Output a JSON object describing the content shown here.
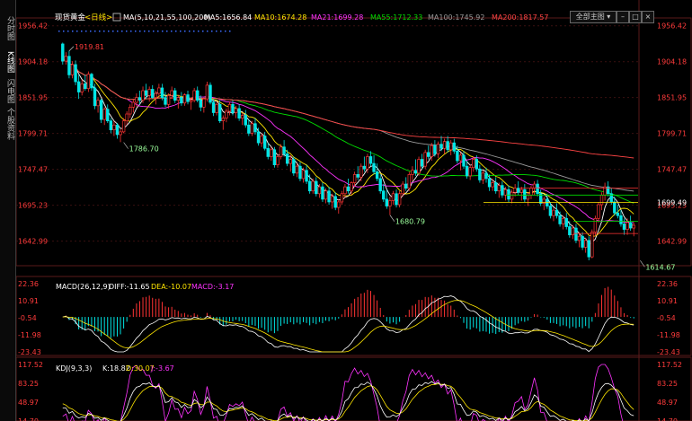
{
  "sidebar": {
    "tabs": [
      {
        "label": "分时图",
        "active": false
      },
      {
        "label": "K线图",
        "active": true
      },
      {
        "label": "闪电图",
        "active": false
      },
      {
        "label": "个股资料",
        "active": false
      }
    ]
  },
  "header": {
    "instrument": "现货黄金",
    "period": "<日线>",
    "ma_title": "MA(5,10,21,55,100,200)",
    "ma5": "MA5:1656.84",
    "ma10": "MA10:1674.28",
    "ma21": "MA21:1699.28",
    "ma55": "MA55:1712.33",
    "ma100": "MA100:1745.92",
    "ma200": "MA200:1817.57",
    "main_select": "全部主图"
  },
  "colors": {
    "up": "#ff3333",
    "down": "#00e5e5",
    "ma5": "#ffffff",
    "ma10": "#ffe600",
    "ma21": "#ff33ff",
    "ma55": "#00dd00",
    "ma100": "#9a9a9a",
    "ma200": "#ff4444",
    "axis_text": "#ff3b3b",
    "grid": "#3a1010"
  },
  "chart_data": [
    {
      "type": "candlestick",
      "title": "现货黄金 <日线>",
      "y_ticks": [
        "1956.42",
        "1904.18",
        "1851.95",
        "1799.71",
        "1747.47",
        "1695.23",
        "1642.99"
      ],
      "ylim": [
        1615,
        1960
      ],
      "annotations": [
        {
          "label": "1919.81",
          "index": 2,
          "value": 1919.81
        },
        {
          "label": "1786.70",
          "index": 19,
          "value": 1786.7
        },
        {
          "label": "1680.79",
          "index": 102,
          "value": 1680.79
        },
        {
          "label": "1614.67",
          "index": 180,
          "value": 1614.67
        }
      ],
      "price_label": "1699.49",
      "ohlc": [
        [
          1930,
          1932,
          1900,
          1905
        ],
        [
          1905,
          1918,
          1900,
          1912
        ],
        [
          1912,
          1920,
          1880,
          1885
        ],
        [
          1885,
          1905,
          1880,
          1900
        ],
        [
          1900,
          1906,
          1870,
          1875
        ],
        [
          1875,
          1885,
          1850,
          1860
        ],
        [
          1860,
          1878,
          1855,
          1872
        ],
        [
          1872,
          1885,
          1862,
          1865
        ],
        [
          1865,
          1890,
          1860,
          1886
        ],
        [
          1886,
          1888,
          1862,
          1866
        ],
        [
          1866,
          1872,
          1835,
          1840
        ],
        [
          1840,
          1852,
          1830,
          1848
        ],
        [
          1848,
          1850,
          1815,
          1820
        ],
        [
          1820,
          1838,
          1812,
          1835
        ],
        [
          1835,
          1842,
          1815,
          1818
        ],
        [
          1818,
          1822,
          1800,
          1805
        ],
        [
          1805,
          1818,
          1796,
          1812
        ],
        [
          1812,
          1815,
          1792,
          1798
        ],
        [
          1798,
          1806,
          1787,
          1802
        ],
        [
          1802,
          1822,
          1800,
          1818
        ],
        [
          1818,
          1832,
          1812,
          1828
        ],
        [
          1828,
          1842,
          1822,
          1838
        ],
        [
          1838,
          1850,
          1830,
          1845
        ],
        [
          1845,
          1858,
          1838,
          1852
        ],
        [
          1852,
          1862,
          1842,
          1848
        ],
        [
          1848,
          1868,
          1844,
          1862
        ],
        [
          1862,
          1872,
          1850,
          1855
        ],
        [
          1855,
          1868,
          1846,
          1864
        ],
        [
          1864,
          1870,
          1850,
          1852
        ],
        [
          1852,
          1862,
          1842,
          1858
        ],
        [
          1858,
          1872,
          1852,
          1866
        ],
        [
          1866,
          1872,
          1848,
          1852
        ],
        [
          1852,
          1860,
          1838,
          1842
        ],
        [
          1842,
          1858,
          1836,
          1855
        ],
        [
          1855,
          1868,
          1850,
          1862
        ],
        [
          1862,
          1866,
          1844,
          1848
        ],
        [
          1848,
          1856,
          1836,
          1852
        ],
        [
          1852,
          1860,
          1840,
          1844
        ],
        [
          1844,
          1858,
          1840,
          1856
        ],
        [
          1856,
          1862,
          1842,
          1846
        ],
        [
          1846,
          1852,
          1834,
          1848
        ],
        [
          1848,
          1866,
          1845,
          1862
        ],
        [
          1862,
          1868,
          1845,
          1848
        ],
        [
          1848,
          1855,
          1832,
          1838
        ],
        [
          1838,
          1852,
          1830,
          1850
        ],
        [
          1850,
          1875,
          1846,
          1870
        ],
        [
          1870,
          1874,
          1842,
          1845
        ],
        [
          1845,
          1850,
          1825,
          1830
        ],
        [
          1830,
          1846,
          1826,
          1842
        ],
        [
          1842,
          1848,
          1815,
          1818
        ],
        [
          1818,
          1826,
          1805,
          1822
        ],
        [
          1822,
          1836,
          1816,
          1832
        ],
        [
          1832,
          1846,
          1826,
          1842
        ],
        [
          1842,
          1848,
          1826,
          1830
        ],
        [
          1830,
          1840,
          1822,
          1836
        ],
        [
          1836,
          1842,
          1818,
          1822
        ],
        [
          1822,
          1830,
          1812,
          1826
        ],
        [
          1826,
          1834,
          1808,
          1812
        ],
        [
          1812,
          1820,
          1796,
          1800
        ],
        [
          1800,
          1818,
          1796,
          1814
        ],
        [
          1814,
          1822,
          1798,
          1802
        ],
        [
          1802,
          1808,
          1782,
          1786
        ],
        [
          1786,
          1800,
          1780,
          1796
        ],
        [
          1796,
          1802,
          1775,
          1778
        ],
        [
          1778,
          1786,
          1762,
          1766
        ],
        [
          1766,
          1780,
          1760,
          1776
        ],
        [
          1776,
          1780,
          1750,
          1754
        ],
        [
          1754,
          1770,
          1750,
          1766
        ],
        [
          1766,
          1784,
          1762,
          1780
        ],
        [
          1780,
          1790,
          1766,
          1770
        ],
        [
          1770,
          1776,
          1752,
          1756
        ],
        [
          1756,
          1768,
          1744,
          1762
        ],
        [
          1762,
          1766,
          1738,
          1742
        ],
        [
          1742,
          1756,
          1736,
          1752
        ],
        [
          1752,
          1758,
          1730,
          1734
        ],
        [
          1734,
          1750,
          1728,
          1746
        ],
        [
          1746,
          1754,
          1726,
          1730
        ],
        [
          1730,
          1740,
          1712,
          1716
        ],
        [
          1716,
          1734,
          1712,
          1730
        ],
        [
          1730,
          1736,
          1708,
          1712
        ],
        [
          1712,
          1726,
          1706,
          1722
        ],
        [
          1722,
          1728,
          1700,
          1704
        ],
        [
          1704,
          1720,
          1698,
          1716
        ],
        [
          1716,
          1722,
          1696,
          1700
        ],
        [
          1700,
          1712,
          1690,
          1708
        ],
        [
          1708,
          1714,
          1688,
          1692
        ],
        [
          1692,
          1704,
          1683,
          1700
        ],
        [
          1700,
          1716,
          1696,
          1712
        ],
        [
          1712,
          1726,
          1706,
          1722
        ],
        [
          1722,
          1734,
          1712,
          1716
        ],
        [
          1716,
          1730,
          1710,
          1728
        ],
        [
          1728,
          1744,
          1722,
          1740
        ],
        [
          1740,
          1752,
          1732,
          1736
        ],
        [
          1736,
          1756,
          1730,
          1752
        ],
        [
          1752,
          1766,
          1744,
          1748
        ],
        [
          1748,
          1770,
          1742,
          1766
        ],
        [
          1766,
          1774,
          1752,
          1756
        ],
        [
          1756,
          1768,
          1740,
          1744
        ],
        [
          1744,
          1756,
          1730,
          1734
        ],
        [
          1734,
          1740,
          1712,
          1716
        ],
        [
          1716,
          1726,
          1700,
          1704
        ],
        [
          1704,
          1718,
          1690,
          1694
        ],
        [
          1694,
          1708,
          1681,
          1702
        ],
        [
          1702,
          1716,
          1696,
          1712
        ],
        [
          1712,
          1718,
          1692,
          1696
        ],
        [
          1696,
          1716,
          1692,
          1712
        ],
        [
          1712,
          1730,
          1708,
          1726
        ],
        [
          1726,
          1736,
          1716,
          1720
        ],
        [
          1720,
          1744,
          1716,
          1740
        ],
        [
          1740,
          1752,
          1730,
          1746
        ],
        [
          1746,
          1762,
          1738,
          1742
        ],
        [
          1742,
          1766,
          1738,
          1762
        ],
        [
          1762,
          1770,
          1748,
          1752
        ],
        [
          1752,
          1776,
          1748,
          1772
        ],
        [
          1772,
          1782,
          1762,
          1766
        ],
        [
          1766,
          1786,
          1760,
          1782
        ],
        [
          1782,
          1790,
          1766,
          1770
        ],
        [
          1770,
          1788,
          1764,
          1784
        ],
        [
          1784,
          1796,
          1774,
          1778
        ],
        [
          1778,
          1792,
          1770,
          1788
        ],
        [
          1788,
          1796,
          1772,
          1776
        ],
        [
          1776,
          1790,
          1768,
          1786
        ],
        [
          1786,
          1792,
          1770,
          1774
        ],
        [
          1774,
          1782,
          1756,
          1760
        ],
        [
          1760,
          1772,
          1746,
          1768
        ],
        [
          1768,
          1774,
          1748,
          1752
        ],
        [
          1752,
          1760,
          1734,
          1738
        ],
        [
          1738,
          1754,
          1732,
          1750
        ],
        [
          1750,
          1766,
          1744,
          1762
        ],
        [
          1762,
          1768,
          1744,
          1748
        ],
        [
          1748,
          1754,
          1728,
          1732
        ],
        [
          1732,
          1746,
          1726,
          1742
        ],
        [
          1742,
          1750,
          1728,
          1734
        ],
        [
          1734,
          1740,
          1716,
          1722
        ],
        [
          1722,
          1734,
          1716,
          1728
        ],
        [
          1728,
          1736,
          1712,
          1716
        ],
        [
          1716,
          1728,
          1706,
          1724
        ],
        [
          1724,
          1730,
          1706,
          1710
        ],
        [
          1710,
          1722,
          1702,
          1718
        ],
        [
          1718,
          1724,
          1700,
          1704
        ],
        [
          1704,
          1718,
          1698,
          1714
        ],
        [
          1714,
          1726,
          1708,
          1720
        ],
        [
          1720,
          1730,
          1710,
          1714
        ],
        [
          1714,
          1722,
          1702,
          1718
        ],
        [
          1718,
          1726,
          1700,
          1704
        ],
        [
          1704,
          1714,
          1694,
          1710
        ],
        [
          1710,
          1724,
          1704,
          1720
        ],
        [
          1720,
          1730,
          1710,
          1726
        ],
        [
          1726,
          1732,
          1708,
          1712
        ],
        [
          1712,
          1718,
          1694,
          1698
        ],
        [
          1698,
          1708,
          1688,
          1704
        ],
        [
          1704,
          1712,
          1690,
          1694
        ],
        [
          1694,
          1700,
          1676,
          1680
        ],
        [
          1680,
          1692,
          1672,
          1688
        ],
        [
          1688,
          1698,
          1676,
          1680
        ],
        [
          1680,
          1686,
          1664,
          1668
        ],
        [
          1668,
          1680,
          1660,
          1676
        ],
        [
          1676,
          1684,
          1660,
          1664
        ],
        [
          1664,
          1672,
          1648,
          1652
        ],
        [
          1652,
          1666,
          1646,
          1662
        ],
        [
          1662,
          1668,
          1640,
          1644
        ],
        [
          1644,
          1656,
          1634,
          1650
        ],
        [
          1650,
          1656,
          1630,
          1634
        ],
        [
          1634,
          1648,
          1626,
          1644
        ],
        [
          1644,
          1650,
          1615,
          1620
        ],
        [
          1620,
          1660,
          1618,
          1656
        ],
        [
          1656,
          1680,
          1650,
          1676
        ],
        [
          1676,
          1700,
          1670,
          1696
        ],
        [
          1696,
          1714,
          1688,
          1710
        ],
        [
          1710,
          1728,
          1702,
          1722
        ],
        [
          1722,
          1730,
          1708,
          1712
        ],
        [
          1712,
          1720,
          1696,
          1700
        ],
        [
          1700,
          1708,
          1680,
          1684
        ],
        [
          1684,
          1696,
          1676,
          1680
        ],
        [
          1680,
          1688,
          1664,
          1668
        ],
        [
          1668,
          1676,
          1652,
          1660
        ],
        [
          1660,
          1676,
          1652,
          1670
        ],
        [
          1670,
          1680,
          1658,
          1662
        ],
        [
          1662,
          1670,
          1650,
          1666
        ]
      ]
    },
    {
      "type": "bar",
      "title": "MACD(26,12,9)",
      "diff": "DIFF:-11.65",
      "dea": "DEA:-10.07",
      "macd": "MACD:-3.17",
      "y_ticks": [
        "22.36",
        "10.91",
        "-0.54",
        "-11.98",
        "-23.43"
      ],
      "ylim": [
        -23.43,
        22.36
      ]
    },
    {
      "type": "line",
      "title": "KDJ(9,3,3)",
      "k": "K:18.82",
      "d": "D:30.07",
      "j": "J:-3.67",
      "y_ticks": [
        "117.52",
        "83.25",
        "48.97",
        "14.70"
      ],
      "ylim": [
        14.7,
        117.52
      ]
    }
  ]
}
